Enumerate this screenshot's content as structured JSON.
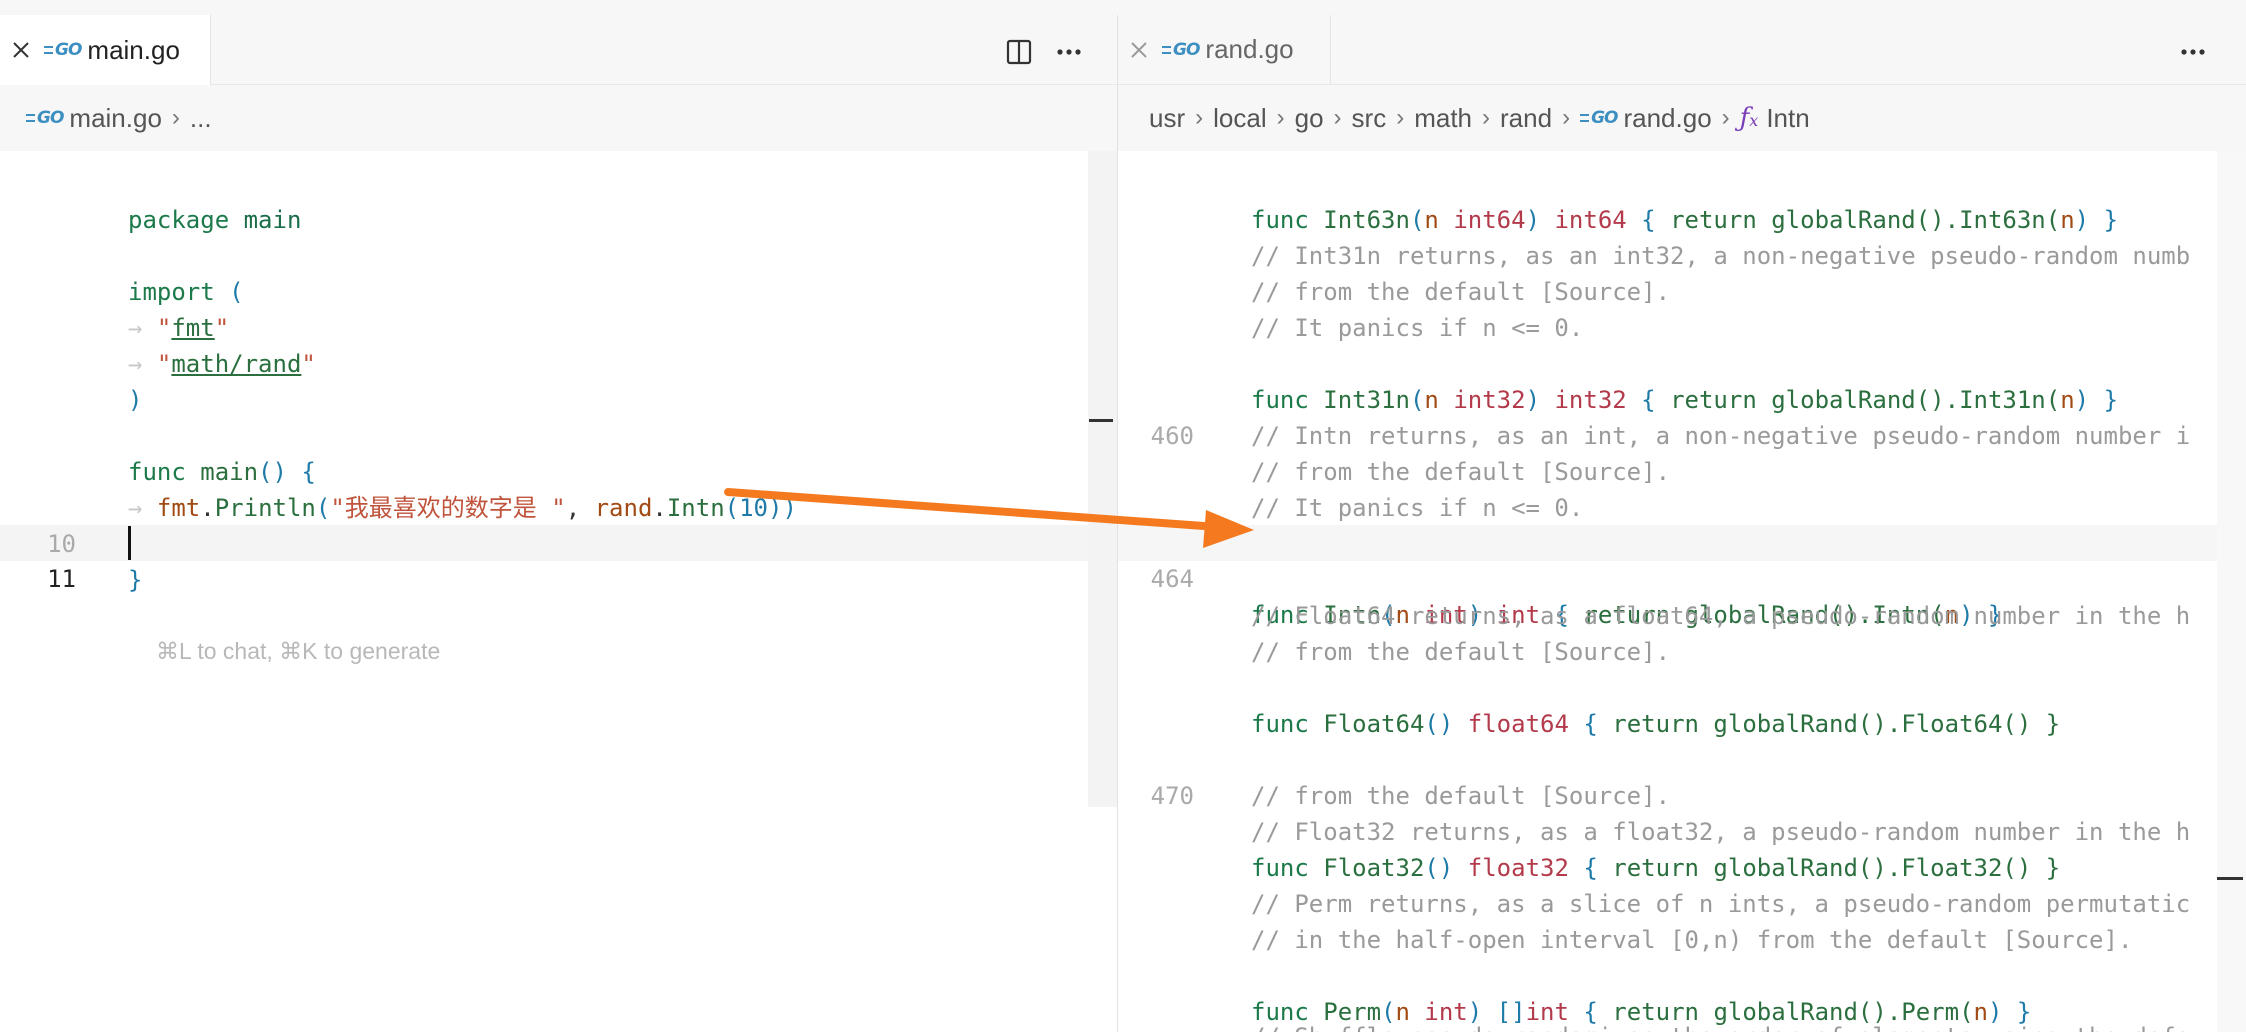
{
  "left_pane": {
    "tab": {
      "filename": "main.go",
      "icon": "go-file-icon"
    },
    "toolbar": {
      "split_icon": "split-editor-icon",
      "more_icon": "more-actions-icon"
    },
    "breadcrumb": {
      "file": "main.go",
      "rest": "..."
    },
    "code": {
      "l1_kw": "package",
      "l1_name": "main",
      "l3_kw": "import",
      "l3_paren": "(",
      "l4_q1": "\"",
      "l4_str": "fmt",
      "l4_q2": "\"",
      "l5_q1": "\"",
      "l5_str": "math/rand",
      "l5_q2": "\"",
      "l6_paren": ")",
      "l8_kw": "func",
      "l8_name": "main",
      "l8_parens": "()",
      "l8_brace": "{",
      "l9_pkg": "fmt",
      "l9_dot": ".",
      "l9_fn": "Println",
      "l9_open": "(",
      "l9_str": "\"我最喜欢的数字是 \"",
      "l9_comma": ", ",
      "l9_pkg2": "rand",
      "l9_dot2": ".",
      "l9_fn2": "Intn",
      "l9_open2": "(",
      "l9_num": "10",
      "l9_close": "))",
      "l10_ln": "10",
      "l10_brace": "}",
      "l11_ln": "11",
      "l11_hint": "⌘L to chat, ⌘K to generate"
    }
  },
  "right_pane": {
    "tab": {
      "filename": "rand.go",
      "icon": "go-file-icon"
    },
    "toolbar": {
      "more_icon": "more-actions-icon"
    },
    "breadcrumb": [
      "usr",
      "local",
      "go",
      "src",
      "math",
      "rand",
      "rand.go",
      "Intn"
    ],
    "line_numbers": {
      "a": "460",
      "b": "464",
      "c": "470"
    },
    "code": {
      "r1": {
        "kw": "func",
        "name": "Int63n",
        "p": "n",
        "pt": "int64",
        "rt": "int64",
        "body": "return globalRand().Int63n(",
        "arg": "n",
        "end": ") }"
      },
      "c1": "// Int31n returns, as an int32, a non-negative pseudo-random numb",
      "c2": "// from the default [Source].",
      "c3": "// It panics if n <= 0.",
      "r2": {
        "kw": "func",
        "name": "Int31n",
        "p": "n",
        "pt": "int32",
        "rt": "int32",
        "body": "return globalRand().Int31n(",
        "arg": "n",
        "end": ") }"
      },
      "c4": "// Intn returns, as an int, a non-negative pseudo-random number i",
      "c5": "// from the default [Source].",
      "c6": "// It panics if n <= 0.",
      "r3": {
        "kw": "func",
        "name": "Intn",
        "p": "n",
        "pt": "int",
        "rt": "int",
        "body": "return globalRand().Intn(",
        "arg": "n",
        "end": ") }"
      },
      "c7": "// Float64 returns, as a float64, a pseudo-random number in the h",
      "c8": "// from the default [Source].",
      "r4": {
        "kw": "func",
        "name": "Float64",
        "rt": "float64",
        "body": "return globalRand().Float64() }"
      },
      "c9": "// Float32 returns, as a float32, a pseudo-random number in the h",
      "c10": "// from the default [Source].",
      "r5": {
        "kw": "func",
        "name": "Float32",
        "rt": "float32",
        "body": "return globalRand().Float32() }"
      },
      "c11": "// Perm returns, as a slice of n ints, a pseudo-random permutatic",
      "c12": "// in the half-open interval [0,n) from the default [Source].",
      "r6": {
        "kw": "func",
        "name": "Perm",
        "p": "n",
        "pt": "int",
        "rt": "[]int",
        "body": "return globalRand().Perm(",
        "arg": "n",
        "end": ") }"
      },
      "c13": "// Shuffle pseudo-randomizes the order of elements using the defa"
    }
  },
  "annotation": {
    "arrow_color": "#f57a1f"
  }
}
